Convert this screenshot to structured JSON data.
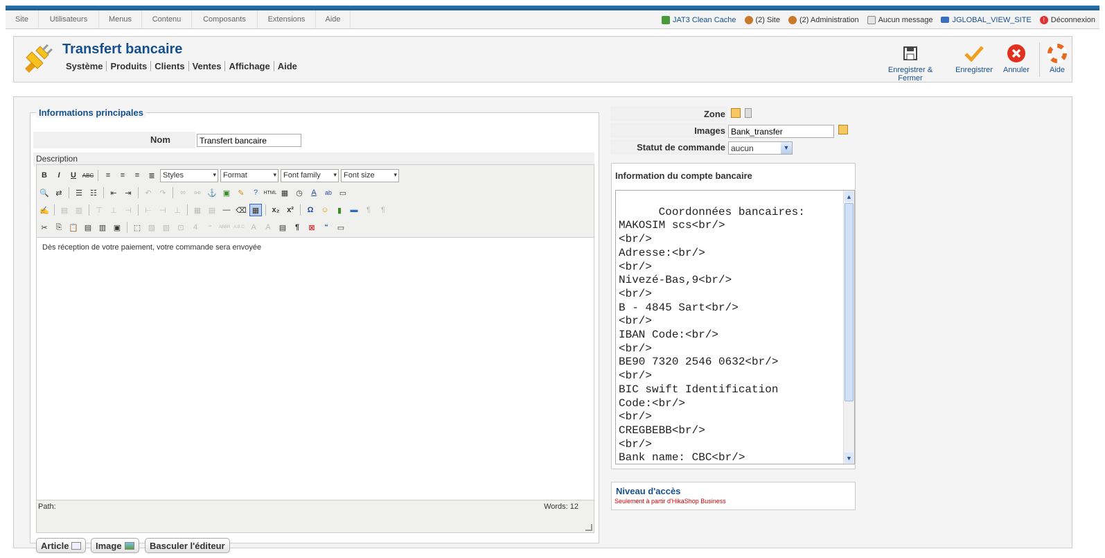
{
  "menu": [
    "Site",
    "Utilisateurs",
    "Menus",
    "Contenu",
    "Composants",
    "Extensions",
    "Aide"
  ],
  "status": {
    "cache": "JAT3 Clean Cache",
    "site": "(2) Site",
    "admin": "(2) Administration",
    "msg": "Aucun message",
    "view": "JGLOBAL_VIEW_SITE",
    "logout": "Déconnexion"
  },
  "page": {
    "title": "Transfert bancaire",
    "submenu": [
      "Système",
      "Produits",
      "Clients",
      "Ventes",
      "Affichage",
      "Aide"
    ]
  },
  "toolbar": {
    "save_close": "Enregistrer & Fermer",
    "save": "Enregistrer",
    "cancel": "Annuler",
    "help": "Aide"
  },
  "form": {
    "legend": "Informations principales",
    "nom_label": "Nom",
    "nom_value": "Transfert bancaire",
    "desc_label": "Description"
  },
  "editor": {
    "styles": "Styles",
    "format": "Format",
    "font_family": "Font family",
    "font_size": "Font size",
    "content": "Dès réception de votre paiement, votre commande sera envoyée",
    "path": "Path:",
    "words": "Words: 12"
  },
  "buttons": {
    "article": "Article",
    "image": "Image",
    "toggle": "Basculer l'éditeur"
  },
  "side": {
    "zone_label": "Zone",
    "images_label": "Images",
    "images_value": "Bank_transfer",
    "statut_label": "Statut de commande",
    "statut_value": "aucun"
  },
  "bank": {
    "title": "Information du compte bancaire",
    "text": "Coordonnées bancaires:\nMAKOSIM scs<br/>\n<br/>\nAdresse:<br/>\n<br/>\nNivezé-Bas,9<br/>\n<br/>\nB - 4845 Sart<br/>\n<br/>\nIBAN Code:<br/>\n<br/>\nBE90 7320 2546 0632<br/>\n<br/>\nBIC swift Identification\nCode:<br/>\n<br/>\nCREGBEBB<br/>\n<br/>\nBank name: CBC<br/>\n<br/>"
  },
  "access": {
    "title": "Niveau d'accès",
    "note": "Seulement à partir d'HikaShop Business"
  }
}
